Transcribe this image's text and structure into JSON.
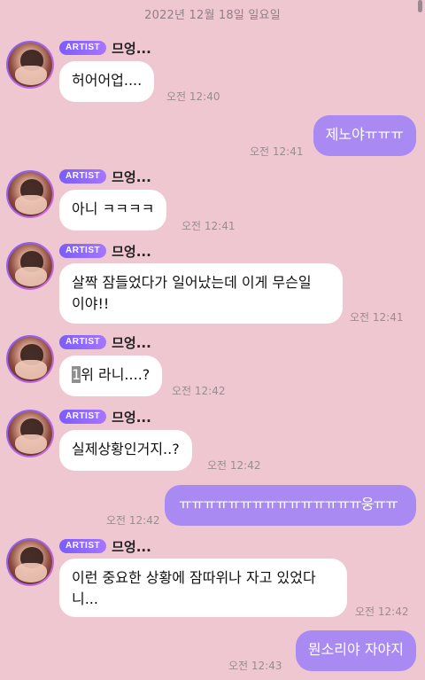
{
  "date_header": "2022년 12월 18일 일요일",
  "sender_badge": "ARTIST",
  "sender_name": "므엉...",
  "messages": [
    {
      "text": "허어어업....",
      "time": "오전 12:40"
    },
    {
      "text": "제노야ㅠㅠㅠ",
      "time": "오전 12:41"
    },
    {
      "text": "아니 ㅋㅋㅋㅋ",
      "time": "오전 12:41"
    },
    {
      "line1": "살짝 잠들었다가 일어났는데 이게 무슨일",
      "line2": "이야!!",
      "time": "오전 12:41"
    },
    {
      "highlighted": "1",
      "rest": "위 라니....?",
      "time": "오전 12:42"
    },
    {
      "text": "실제상황인거지..?",
      "time": "오전 12:42"
    },
    {
      "text": "ㅠㅠㅠㅠㅠㅠㅠㅠㅠㅠㅠㅠㅠㅠㅠ웅ㅠㅠ",
      "time": "오전 12:42"
    },
    {
      "line1": "이런 중요한 상황에 잠따위나 자고 있었다",
      "line2": "니...",
      "time": "오전 12:42"
    },
    {
      "text": "뭔소리야 자야지",
      "time": "오전 12:43"
    }
  ]
}
